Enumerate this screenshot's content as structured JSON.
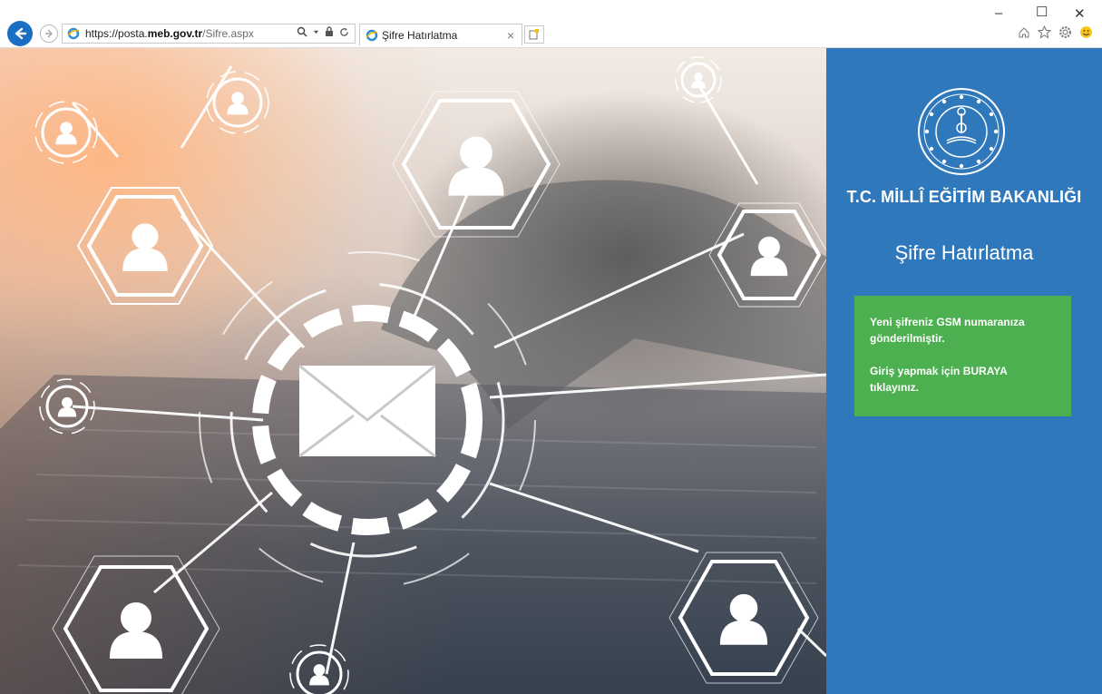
{
  "browser": {
    "url_prefix": "https://posta.",
    "url_host": "meb.gov.tr",
    "url_path": "/Sifre.aspx",
    "tab_title": "Şifre Hatırlatma",
    "tab_close": "×",
    "window_controls": {
      "minimize": "–",
      "maximize": "☐",
      "close": "✕"
    },
    "icons": [
      "back-icon",
      "forward-icon",
      "ie-icon",
      "search-icon",
      "lock-icon",
      "refresh-icon",
      "new-tab-icon",
      "home-icon",
      "favorites-star-icon",
      "settings-gear-icon",
      "smiley-feedback-icon"
    ]
  },
  "panel": {
    "org_name": "T.C. MİLLÎ EĞİTİM BAKANLIĞI",
    "page_title": "Şifre Hatırlatma",
    "alert": {
      "line1": "Yeni şifreniz GSM numaranıza gönderilmiştir.",
      "line2": "Giriş yapmak için BURAYA tıklayınız."
    }
  },
  "colors": {
    "panel_blue": "#2f78bb",
    "alert_green": "#4caf50",
    "back_button_blue": "#1a6fc4"
  }
}
